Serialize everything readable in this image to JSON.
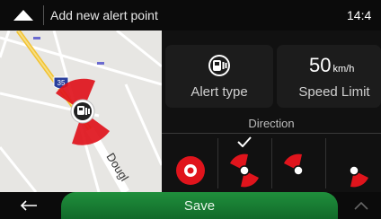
{
  "header": {
    "title": "Add new alert point",
    "clock": "14:4"
  },
  "map": {
    "road_shield": "35",
    "street_label": "Dougl"
  },
  "panel": {
    "alert_type_label": "Alert type",
    "speed_value": "50",
    "speed_unit": "km/h",
    "speed_label": "Speed Limit",
    "direction_label": "Direction",
    "direction_options": [
      {
        "name": "all-directions",
        "selected": false
      },
      {
        "name": "two-directions",
        "selected": true
      },
      {
        "name": "one-direction-a",
        "selected": false
      },
      {
        "name": "one-direction-b",
        "selected": false
      }
    ]
  },
  "footer": {
    "save_label": "Save"
  },
  "colors": {
    "accent_green": "#1f8f3c",
    "alert_red": "#e0141c",
    "map_bg": "#e7e6e3",
    "panel_bg": "#111111"
  },
  "icons": {
    "header_left": "chevron-up-icon",
    "alert_type": "speed-camera-icon",
    "check": "checkmark-icon",
    "back": "arrow-left-icon",
    "footer_right": "chevron-up-icon"
  }
}
